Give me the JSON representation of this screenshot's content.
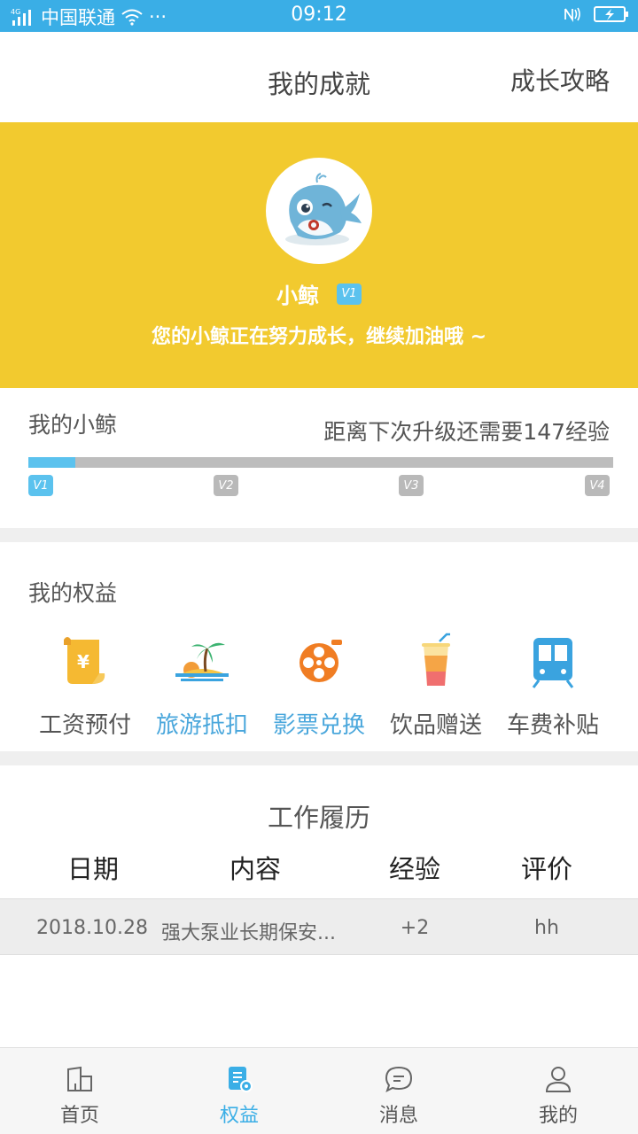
{
  "status_bar": {
    "network": "4G",
    "carrier": "中国联通",
    "dots": "···",
    "time": "09:12"
  },
  "header": {
    "title": "我的成就",
    "link": "成长攻略"
  },
  "profile": {
    "name": "小鲸",
    "level": "V1",
    "motto": "您的小鲸正在努力成长，继续加油哦 ~"
  },
  "growth": {
    "title": "我的小鲸",
    "hint": "距离下次升级还需要147经验",
    "progress_fraction": 0.08,
    "levels": [
      "V1",
      "V2",
      "V3",
      "V4"
    ]
  },
  "benefits": {
    "title": "我的权益",
    "items": [
      {
        "label": "工资预付",
        "icon": "salary-scroll-icon"
      },
      {
        "label": "旅游抵扣",
        "icon": "island-palm-icon"
      },
      {
        "label": "影票兑换",
        "icon": "film-reel-icon"
      },
      {
        "label": "饮品赠送",
        "icon": "drink-cup-icon"
      },
      {
        "label": "车费补贴",
        "icon": "train-icon"
      }
    ]
  },
  "history": {
    "title": "工作履历",
    "columns": [
      "日期",
      "内容",
      "经验",
      "评价"
    ],
    "rows": [
      {
        "date": "2018.10.28",
        "content": "强大泵业长期保安...",
        "exp": "+2",
        "rating": "hh"
      }
    ]
  },
  "tabbar": {
    "items": [
      {
        "label": "首页",
        "icon": "home-building-icon"
      },
      {
        "label": "权益",
        "icon": "benefits-doc-icon"
      },
      {
        "label": "消息",
        "icon": "chat-bubble-icon"
      },
      {
        "label": "我的",
        "icon": "person-icon"
      }
    ],
    "active_index": 1
  },
  "colors": {
    "status_bar": "#3aaee6",
    "banner": "#f2ca2f",
    "accent": "#5bc2ee",
    "progress_track": "#bdbdbd"
  }
}
